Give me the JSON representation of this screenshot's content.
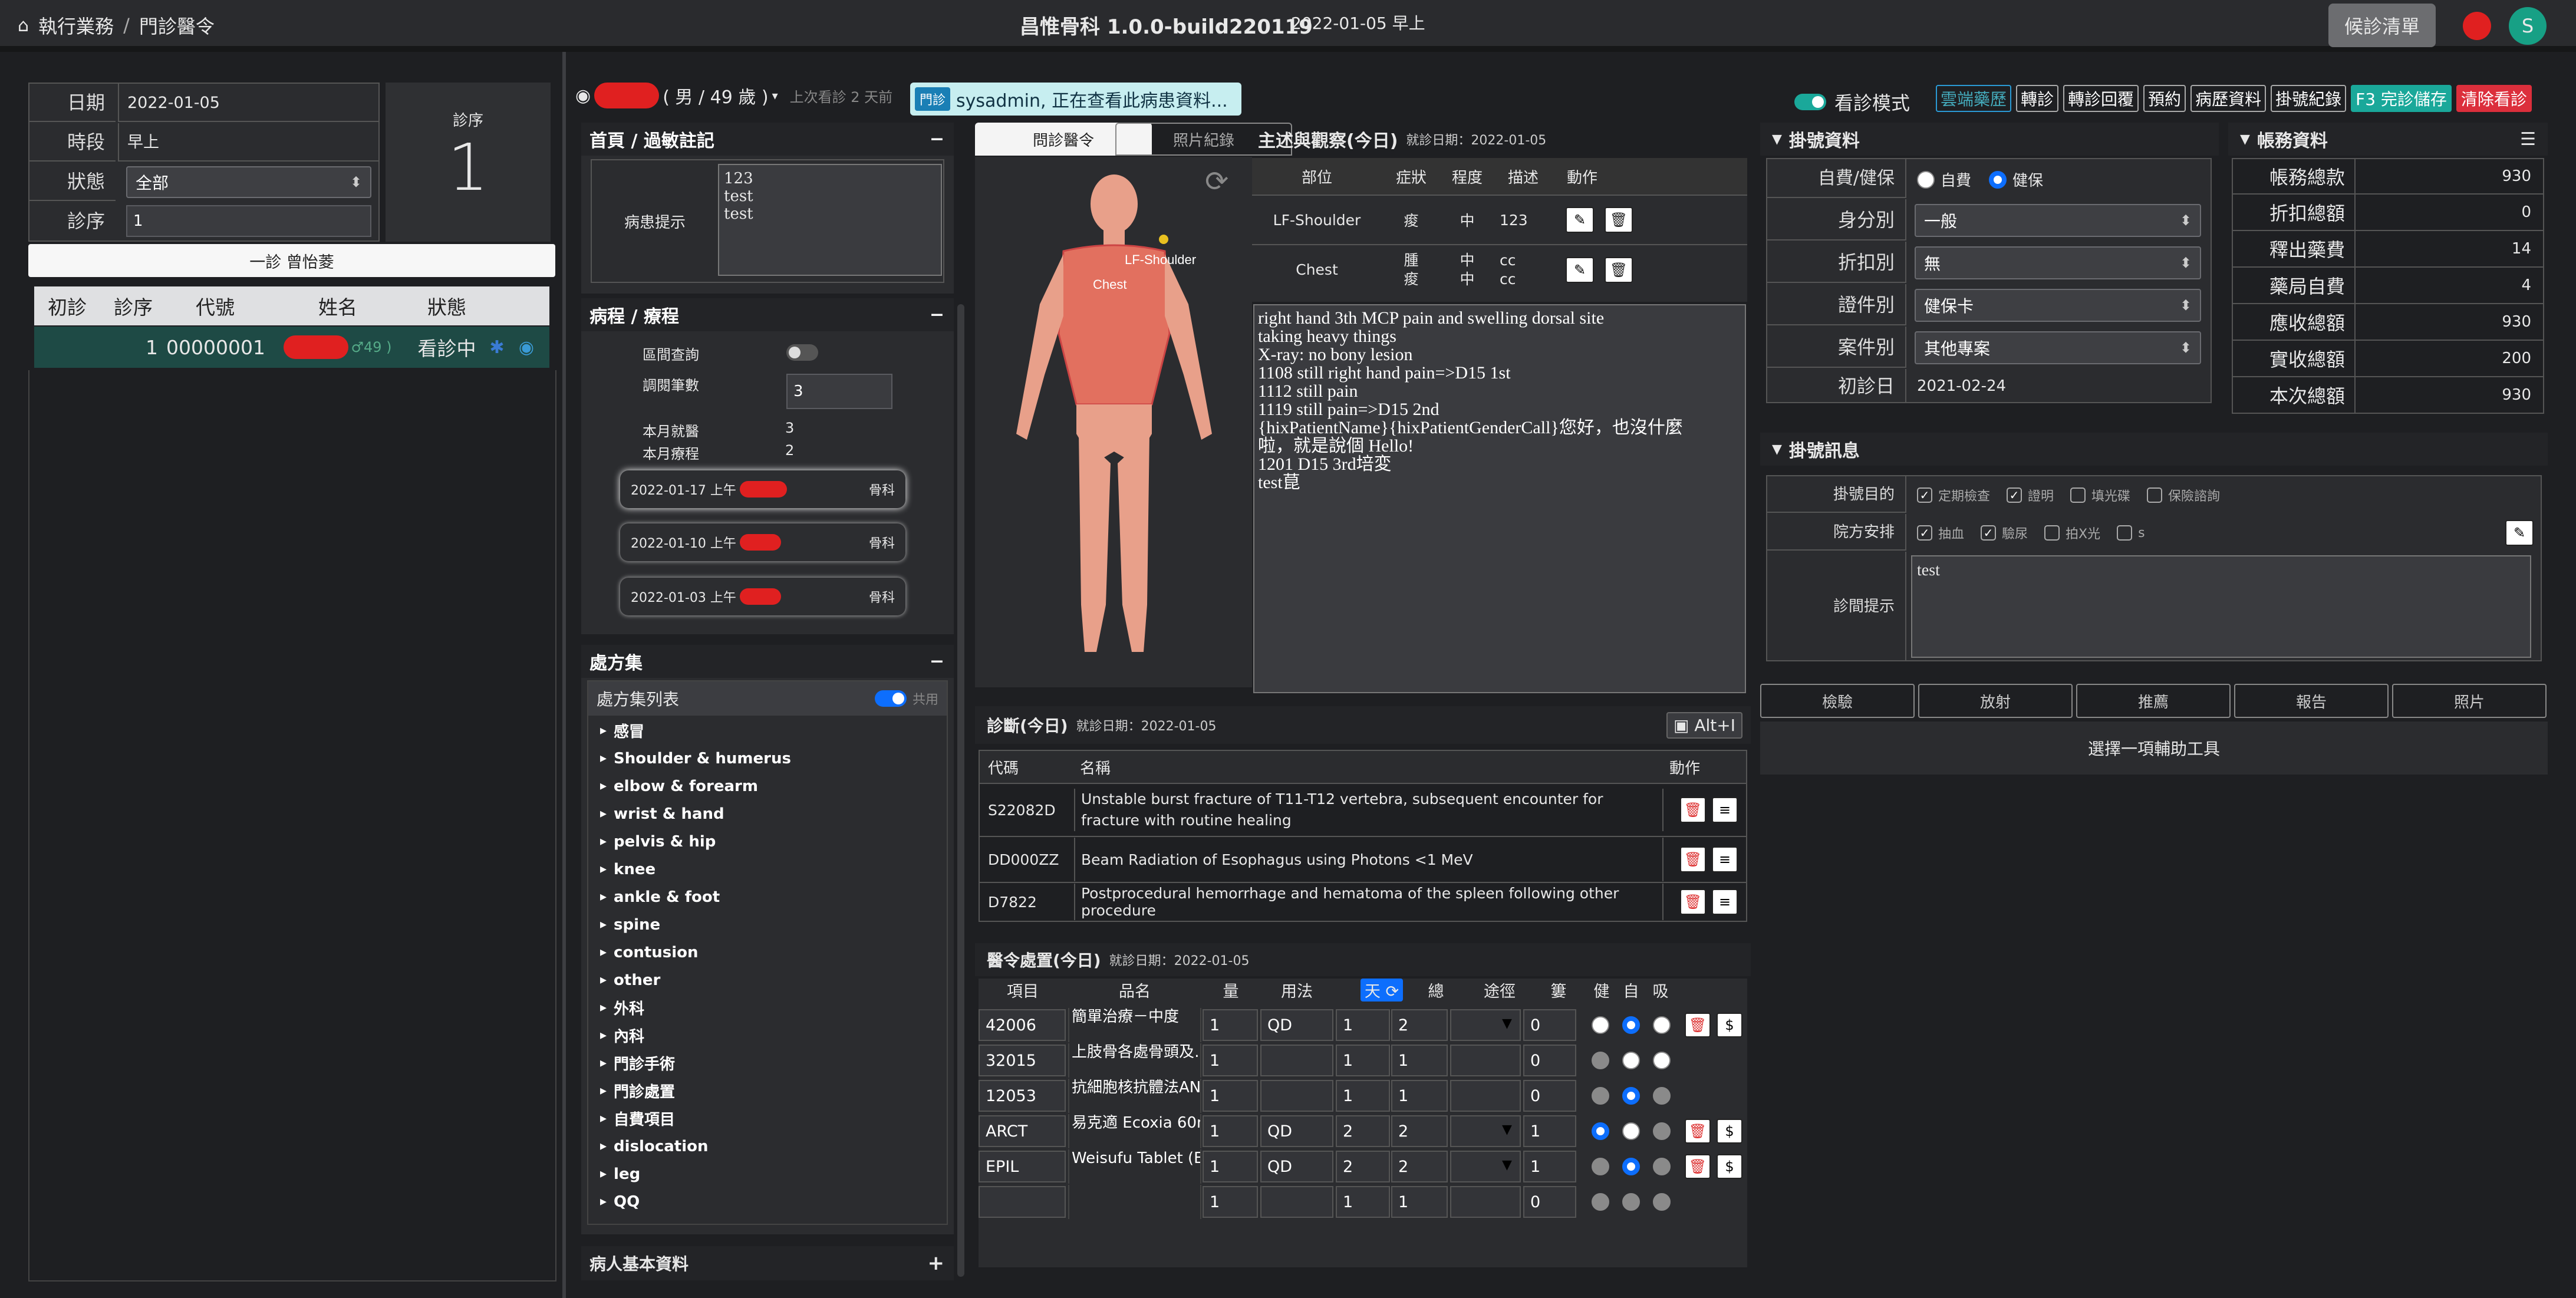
{
  "nav": {
    "home_label": "執行業務",
    "sep": "/",
    "page": "門診醫令"
  },
  "app": {
    "title": "昌惟骨科 1.0.0-build220119",
    "date": "2022-01-05 早上",
    "queue_button": "候診清單",
    "avatar": "S",
    "colors": {
      "accent": "#0d6efd",
      "red": "#e02020",
      "green": "#17a085",
      "teal": "#1aa89a"
    }
  },
  "left": {
    "date_label": "日期",
    "date_value": "2022-01-05",
    "slot_label": "時段",
    "slot_value": "早上",
    "status_label": "狀態",
    "status_value": "全部",
    "seq_label": "診序",
    "seq_value": "1",
    "big_seq_label": "診序",
    "big_seq_value": "1",
    "first_visit_button": "一診 曾怡菱",
    "table_headers": [
      "初診",
      "診序",
      "代號",
      "姓名",
      "狀態"
    ],
    "row": {
      "seq": "1",
      "code": "00000001",
      "age_tail": "♂49 )",
      "status": "看診中"
    }
  },
  "patient": {
    "info": "( 男 / 49 歲 )",
    "last_visit": "上次看診 2 天前",
    "notice_tag": "門診",
    "notice_text": "sysadmin, 正在查看此病患資料..."
  },
  "toolbar": {
    "mode_label": "看診模式",
    "buttons": [
      "雲端藥歷",
      "轉診",
      "轉診回覆",
      "預約",
      "病歷資料",
      "掛號紀錄"
    ],
    "save": "F3 完診儲存",
    "clear": "清除看診"
  },
  "allergy": {
    "title": "首頁 / 過敏註記",
    "hint_label": "病患提示",
    "hint_text": "123\ntest\ntest"
  },
  "course": {
    "title": "病程 / 療程",
    "interval_label": "區間查詢",
    "count_label": "調閱筆數",
    "count_value": "3",
    "month_visits_label": "本月就醫",
    "month_visits_value": "3",
    "month_course_label": "本月療程",
    "month_course_value": "2",
    "visits": [
      {
        "date": "2022-01-17 上午",
        "dept": "骨科"
      },
      {
        "date": "2022-01-10 上午",
        "dept": "骨科"
      },
      {
        "date": "2022-01-03 上午",
        "dept": "骨科"
      }
    ]
  },
  "rx_set": {
    "title": "處方集",
    "list_title": "處方集列表",
    "share_label": "共用",
    "items": [
      "感冒",
      "Shoulder & humerus",
      "elbow & forearm",
      "wrist & hand",
      "pelvis & hip",
      "knee",
      "ankle & foot",
      "spine",
      "contusion",
      "other",
      "外科",
      "內科",
      "門診手術",
      "門診處置",
      "自費項目",
      "dislocation",
      "leg",
      "QQ"
    ]
  },
  "basic_info": {
    "title": "病人基本資料"
  },
  "tabs": {
    "tab1": "問診醫令",
    "tab2": "照片紀錄"
  },
  "complaint": {
    "title": "主述與觀察(今日)",
    "date": "就診日期：2022-01-05",
    "headers": [
      "部位",
      "症狀",
      "程度",
      "描述",
      "動作"
    ],
    "rows": [
      {
        "part": "LF-Shoulder",
        "symptom": "痠",
        "level": "中",
        "desc": "123"
      },
      {
        "part": "Chest",
        "symptom": "腫\n痠",
        "level": "中\n中",
        "desc": "cc\ncc"
      }
    ],
    "text": "right hand 3th MCP pain and swelling dorsal site\ntaking heavy things\nX-ray: no bony lesion\n1108 still right hand pain=>D15 1st\n1112 still pain\n1119 still pain=>D15 2nd\n{hixPatientName}{hixPatientGenderCall}您好，也沒什麼\n啦，就是說個 Hello!\n1201 D15 3rd培変\ntest菎"
  },
  "body": {
    "label1": "LF-Shoulder",
    "label2": "Chest"
  },
  "diagnosis": {
    "title": "診斷(今日)",
    "date": "就診日期：2022-01-05",
    "shortcut": "Alt+I",
    "headers": [
      "代碼",
      "名稱",
      "動作"
    ],
    "rows": [
      {
        "code": "S22082D",
        "name": "Unstable burst fracture of T11-T12 vertebra, subsequent encounter for fracture with routine healing"
      },
      {
        "code": "DD000ZZ",
        "name": "Beam Radiation of Esophagus using Photons <1 MeV"
      },
      {
        "code": "D7822",
        "name": "Postprocedural hemorrhage and hematoma of the spleen following other procedure"
      }
    ]
  },
  "orders": {
    "title": "醫令處置(今日)",
    "date": "就診日期：2022-01-05",
    "headers": [
      "項目",
      "品名",
      "量",
      "用法",
      "天",
      "總",
      "途徑",
      "簍",
      "健",
      "自",
      "吸"
    ],
    "rows": [
      {
        "item": "42006",
        "name": "簡單治療－中度",
        "qty": "1",
        "usage": "QD",
        "days": "1",
        "total": "2",
        "route": "",
        "pack": "0"
      },
      {
        "item": "32015",
        "name": "上肢骨各處骨頭及…",
        "qty": "1",
        "usage": "",
        "days": "1",
        "total": "1",
        "route": "",
        "pack": "0"
      },
      {
        "item": "12053",
        "name": "抗細胞核抗體法ANA",
        "qty": "1",
        "usage": "",
        "days": "1",
        "total": "1",
        "route": "",
        "pack": "0"
      },
      {
        "item": "ARCT",
        "name": "易克適 Ecoxia 60m…",
        "qty": "1",
        "usage": "QD",
        "days": "2",
        "total": "2",
        "route": "",
        "pack": "1"
      },
      {
        "item": "EPIL",
        "name": "Weisufu Tablet (Epi…",
        "qty": "1",
        "usage": "QD",
        "days": "2",
        "total": "2",
        "route": "",
        "pack": "1"
      },
      {
        "item": "",
        "name": "",
        "qty": "1",
        "usage": "",
        "days": "1",
        "total": "1",
        "route": "",
        "pack": "0"
      }
    ]
  },
  "registration": {
    "title": "掛號資料",
    "pay_label": "自費/健保",
    "pay_opt1": "自費",
    "pay_opt2": "健保",
    "identity_label": "身分別",
    "identity_value": "一般",
    "discount_label": "折扣別",
    "discount_value": "無",
    "cert_label": "證件別",
    "cert_value": "健保卡",
    "case_label": "案件別",
    "case_value": "其他專案",
    "first_label": "初診日",
    "first_value": "2021-02-24"
  },
  "account": {
    "title": "帳務資料",
    "rows": [
      {
        "label": "帳務總款",
        "value": "930"
      },
      {
        "label": "折扣總額",
        "value": "0"
      },
      {
        "label": "釋出藥費",
        "value": "14"
      },
      {
        "label": "藥局自費",
        "value": "4"
      },
      {
        "label": "應收總額",
        "value": "930"
      },
      {
        "label": "實收總額",
        "value": "200"
      },
      {
        "label": "本次總額",
        "value": "930"
      }
    ]
  },
  "reg_info": {
    "title": "掛號訊息",
    "purpose_label": "掛號目的",
    "purpose_opts": [
      "定期檢查",
      "證明",
      "填光碟",
      "保險諮詢"
    ],
    "arrange_label": "院方安排",
    "arrange_opts": [
      "抽血",
      "驗尿",
      "拍X光",
      "s"
    ],
    "hint_label": "診間提示",
    "hint_text": "test"
  },
  "tools": {
    "tabs": [
      "檢驗",
      "放射",
      "推薦",
      "報告",
      "照片"
    ],
    "placeholder": "選擇一項輔助工具"
  }
}
